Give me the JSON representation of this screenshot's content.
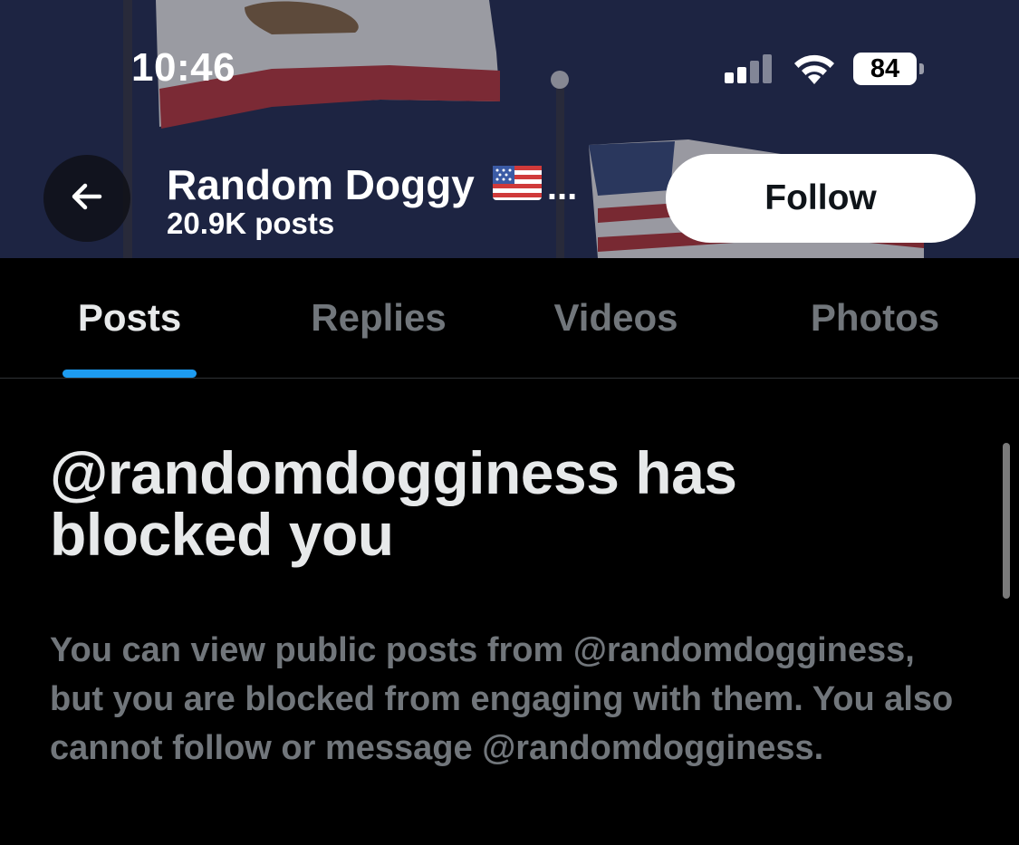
{
  "status_bar": {
    "time": "10:46",
    "battery_level": "84",
    "signal_icon": "cellular-signal-icon",
    "wifi_icon": "wifi-icon"
  },
  "header": {
    "back_icon": "back-arrow-icon",
    "profile_name": "Random Doggy",
    "flag_icon": "us-flag-emoji",
    "name_truncation": "...",
    "post_count": "20.9K posts",
    "follow_label": "Follow"
  },
  "tabs": [
    {
      "label": "Posts",
      "active": true
    },
    {
      "label": "Replies",
      "active": false
    },
    {
      "label": "Videos",
      "active": false
    },
    {
      "label": "Photos",
      "active": false
    }
  ],
  "blocked": {
    "title": "@randomdogginess has blocked you",
    "description": "You can view public posts from @randomdogginess, but you are blocked from engaging with them. You also cannot follow or message @randomdogginess."
  },
  "colors": {
    "background": "#000000",
    "active_tab_indicator": "#1d9bf0",
    "primary_text": "#e7e9ea",
    "secondary_text": "#71767b",
    "follow_button_bg": "#ffffff"
  }
}
